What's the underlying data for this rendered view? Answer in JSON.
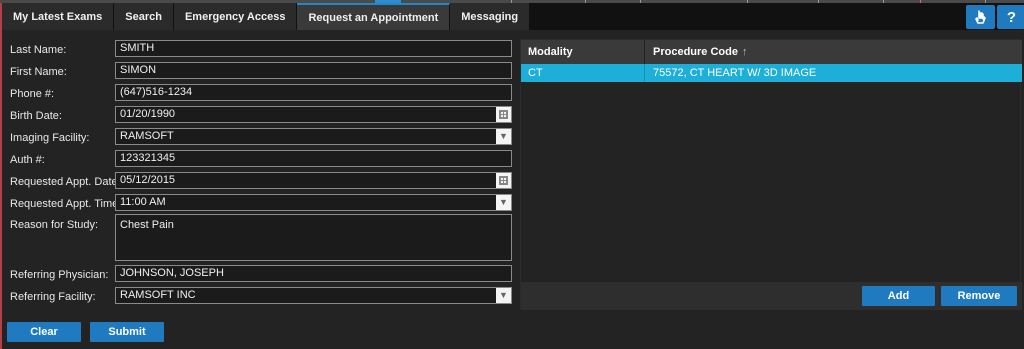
{
  "tabs": [
    {
      "label": "My Latest Exams"
    },
    {
      "label": "Search"
    },
    {
      "label": "Emergency Access"
    },
    {
      "label": "Request an Appointment"
    },
    {
      "label": "Messaging"
    }
  ],
  "topbar": {
    "help_label": "?"
  },
  "form": {
    "last_name": {
      "label": "Last Name:",
      "value": "SMITH"
    },
    "first_name": {
      "label": "First Name:",
      "value": "SIMON"
    },
    "phone": {
      "label": "Phone #:",
      "value": "(647)516-1234"
    },
    "birth_date": {
      "label": "Birth Date:",
      "value": "01/20/1990"
    },
    "imaging_facility": {
      "label": "Imaging Facility:",
      "value": "RAMSOFT"
    },
    "auth": {
      "label": "Auth #:",
      "value": "123321345"
    },
    "appt_date": {
      "label": "Requested Appt. Date:",
      "value": "05/12/2015"
    },
    "appt_time": {
      "label": "Requested Appt. Time:",
      "value": "11:00 AM"
    },
    "reason": {
      "label": "Reason for Study:",
      "value": "Chest Pain"
    },
    "ref_physician": {
      "label": "Referring Physician:",
      "value": "JOHNSON, JOSEPH"
    },
    "ref_facility": {
      "label": "Referring Facility:",
      "value": "RAMSOFT INC"
    }
  },
  "buttons": {
    "clear": "Clear",
    "submit": "Submit",
    "add": "Add",
    "remove": "Remove"
  },
  "grid": {
    "columns": [
      {
        "label": "Modality"
      },
      {
        "label": "Procedure Code"
      }
    ],
    "sort_indicator": "↑",
    "rows": [
      {
        "modality": "CT",
        "procedure": "75572, CT HEART W/ 3D IMAGE"
      }
    ]
  },
  "colors": {
    "accent": "#1f7ac0",
    "selected_row": "#1dafd8",
    "background": "#232323"
  }
}
